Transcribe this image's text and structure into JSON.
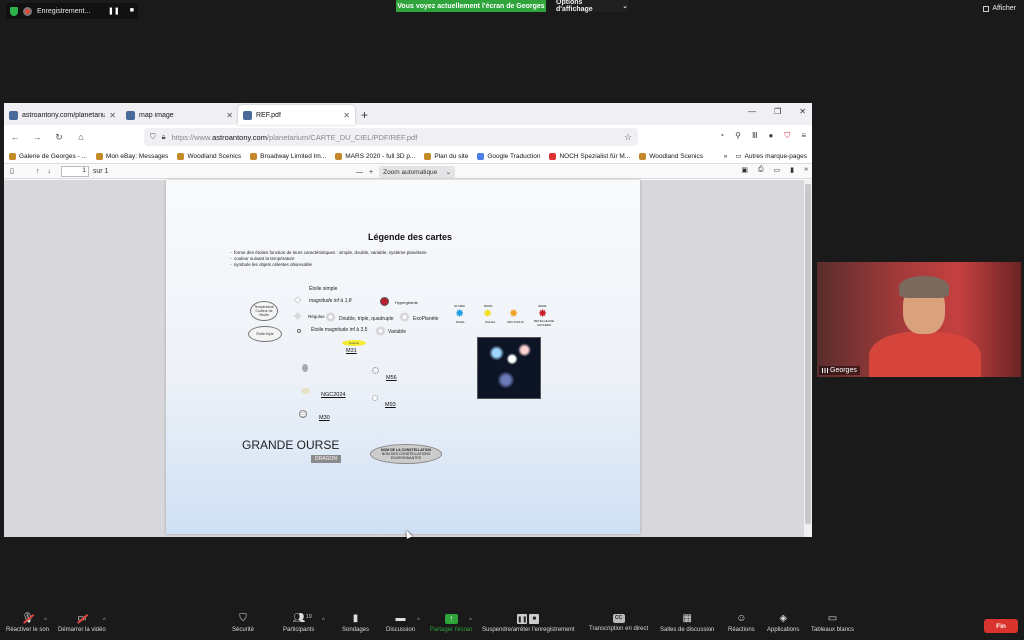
{
  "zoom_top": {
    "recording_label": "Enregistrement...",
    "share_banner": "Vous voyez actuellement l'écran de Georges",
    "view_options": "Options d'affichage",
    "afficher": "Afficher"
  },
  "browser": {
    "tabs": [
      {
        "label": "astroantony.com/planetarium/"
      },
      {
        "label": "map image"
      },
      {
        "label": "REF.pdf"
      }
    ],
    "url": {
      "scheme": "https://www.",
      "host": "astroantony.com",
      "path": "/planetarium/CARTE_DU_CIEL/PDF/REF.pdf"
    },
    "bookmarks": [
      "Galerie de Georges - ...",
      "Mon eBay: Messages",
      "Woodland Scenics",
      "Broadway Limited Im...",
      "MARS 2020 - full 3D p...",
      "Plan du site",
      "Google Traduction",
      "NOCH Spezialist für M...",
      "Woodland Scenics"
    ],
    "other_bookmarks": "Autres marque-pages",
    "pdf_toolbar": {
      "page_number": "1",
      "page_total": "sur 1",
      "zoom": "Zoom automatique"
    }
  },
  "pdf": {
    "title": "Légende des cartes",
    "bullets": [
      "forme des étoiles fonction de leurs caractéristiques : simple, double, variable, système planétaire",
      "couleur suivant la température",
      "symbole les objets célestes observable"
    ],
    "etoile_simple": "Étoile simple",
    "magnitude_1_8": "magnitude inf à 1,8",
    "regulus": "Régulus",
    "double": "Double, triple, quadruple",
    "exoplanete": "ExoPlanète",
    "hypergeante": "Hypergéante",
    "magnitude_3_5": "Étoile magnitude inf à 3,5",
    "variable": "Variable",
    "bubble_temp": "Température Couleur de l'étoile",
    "bubble_triple": "Étoile triple",
    "m31_tag": "Galaxie",
    "m31": "M31",
    "m56": "M56",
    "ngc2024": "NGC2024",
    "m93": "M93",
    "m30": "M30",
    "star_temps": [
      "30 000K",
      "6000K",
      "",
      "3000K"
    ],
    "star_names": [
      "RIGEL",
      "SOLEIL",
      "ARCTURUS",
      "BETELGEUSE ANTARES"
    ],
    "big_title": "GRANDE OURSE",
    "dragon": "DRAGON",
    "nom_line1": "NOM DE LA CONSTELLATION",
    "nom_line2": "NOM DES CONSTELLATIONS ENVIRONNANTES"
  },
  "video": {
    "name": "Georges"
  },
  "zoom_bottom": {
    "mute": "Réactiver le son",
    "video": "Démarrer la vidéo",
    "security": "Sécurité",
    "participants": "Participants",
    "participants_count": "19",
    "polls": "Sondages",
    "chat": "Discussion",
    "share": "Partager l'écran",
    "record": "Suspendre/arrêter l'enregistrement",
    "cc": "Transcription en direct",
    "breakout": "Salles de discussion",
    "reactions": "Réactions",
    "apps": "Applications",
    "whiteboards": "Tableaux blancs",
    "end": "Fin"
  },
  "colors": {
    "zoom_green": "#2ea43b",
    "end_red": "#d8332d",
    "firefox_shield": "#d7264a"
  }
}
